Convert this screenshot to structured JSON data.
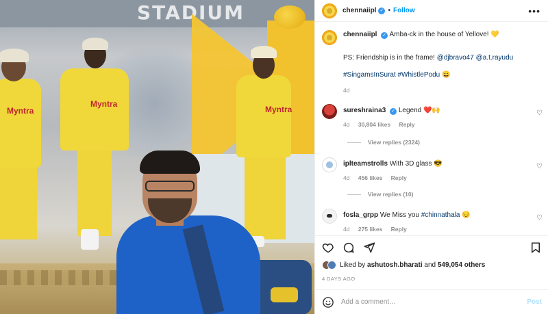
{
  "photo": {
    "stadium_sign": "STADIUM",
    "sponsor": "Myntra",
    "alt": "Fan posing in front of CSK players graphic"
  },
  "post": {
    "author": "chennaiipl",
    "follow_label": "Follow",
    "more_label": "•••",
    "caption_text": "Amba-ck in the house of Yellove! 💛",
    "ps_prefix": "PS: Friendship is in the frame!",
    "ps_mentions": [
      "@djbravo47",
      "@a.t.rayudu"
    ],
    "hashtags": "#SingamsInSurat #WhistlePodu 😄",
    "caption_age": "4d"
  },
  "comments": [
    {
      "user": "sureshraina3",
      "text": "Legend ❤️🙌",
      "age": "4d",
      "likes": "30,804 likes",
      "reply": "Reply",
      "view_replies": "View replies (2324)"
    },
    {
      "user": "iplteamstrolls",
      "text": "With 3D glass 😎",
      "age": "4d",
      "likes": "456 likes",
      "reply": "Reply",
      "view_replies": "View replies (10)"
    },
    {
      "user": "fosla_grpp",
      "text": "We Miss you ",
      "tag": "#chinnathala",
      "emoji": " 😔",
      "age": "4d",
      "likes": "275 likes",
      "reply": "Reply"
    }
  ],
  "likes": {
    "prefix": "Liked by",
    "first_user": "ashutosh.bharati",
    "middle": "and",
    "others": "549,054 others"
  },
  "time_ago": "4 DAYS AGO",
  "add_comment": {
    "placeholder": "Add a comment…",
    "post_label": "Post"
  },
  "colors": {
    "link": "#00376b",
    "accent": "#0095f6",
    "verified": "#3897f0",
    "muted": "#8e8e8e"
  }
}
